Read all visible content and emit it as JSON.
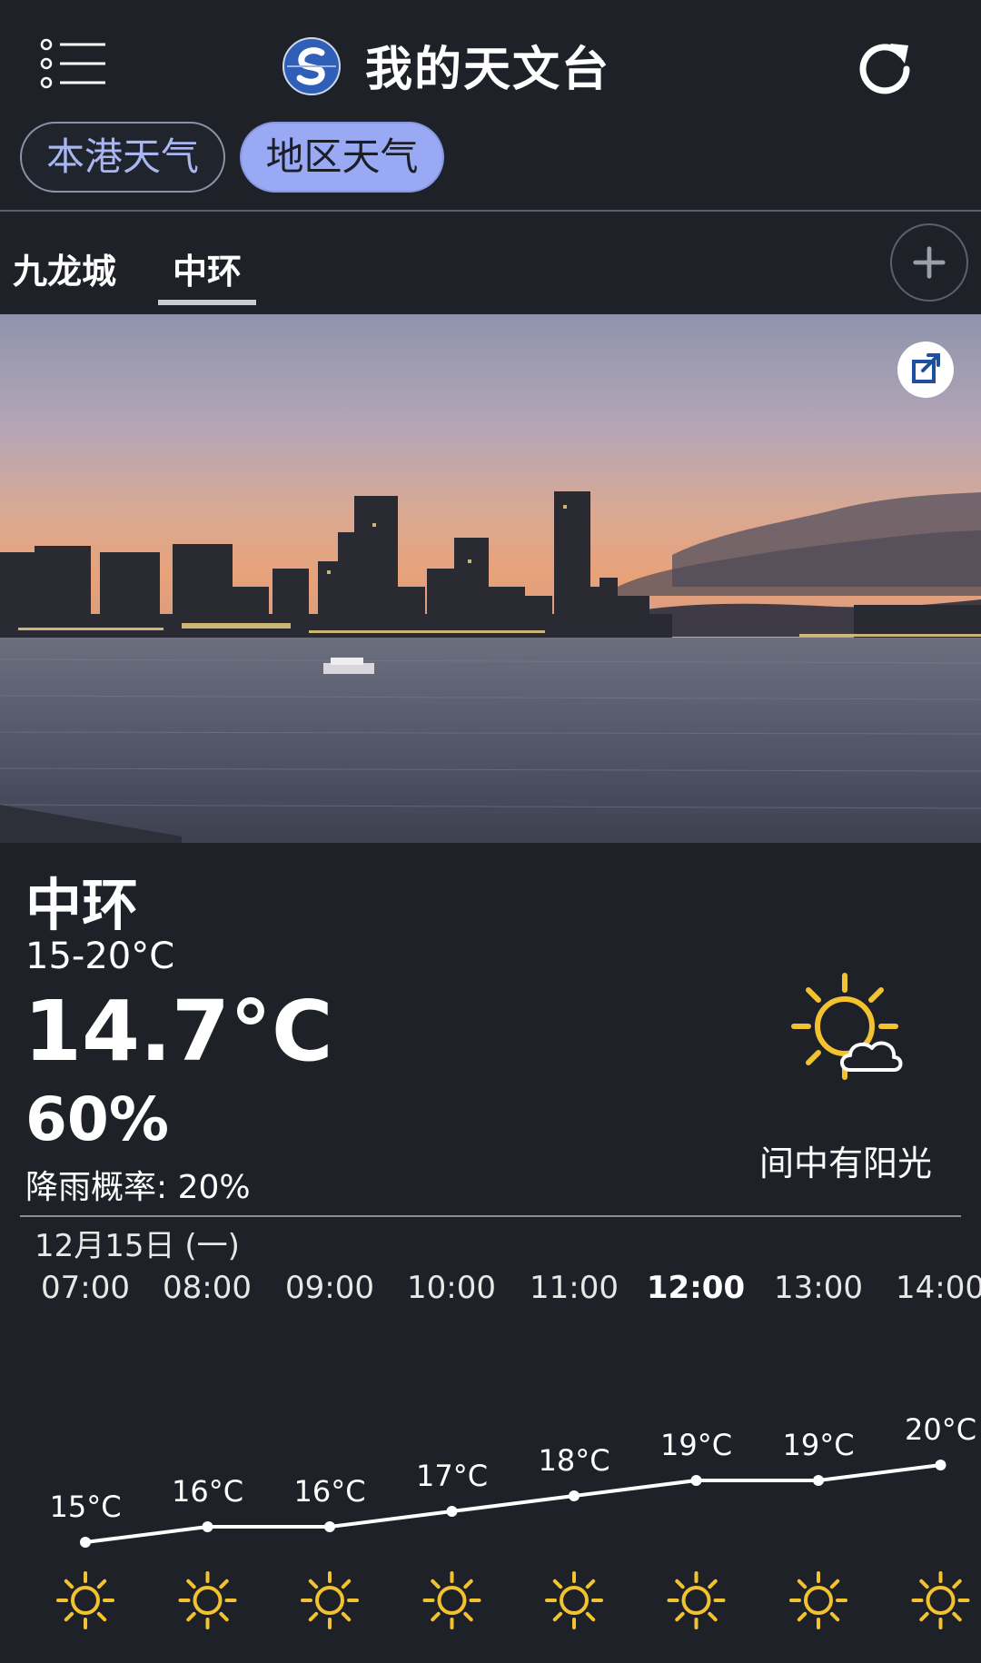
{
  "app": {
    "title": "我的天文台"
  },
  "modes": {
    "local": "本港天气",
    "region": "地区天气"
  },
  "locations": [
    {
      "name": "九龙城"
    },
    {
      "name": "中环",
      "selected": true
    }
  ],
  "current": {
    "place": "中环",
    "temp_range": "15-20°C",
    "temperature": "14.7°C",
    "humidity": "60%",
    "rain_probability": "降雨概率: 20%",
    "description": "间中有阳光",
    "icon": "sunny-periods-icon"
  },
  "hourly": {
    "date": "12月15日 (一)",
    "hours": [
      "07:00",
      "08:00",
      "09:00",
      "10:00",
      "11:00",
      "12:00",
      "13:00",
      "14:00"
    ],
    "active_hour": "12:00",
    "temp_labels": [
      "15°C",
      "16°C",
      "16°C",
      "17°C",
      "18°C",
      "19°C",
      "19°C",
      "20°C"
    ],
    "icon": "sun-icon"
  },
  "chart_data": {
    "type": "line",
    "x": [
      "07:00",
      "08:00",
      "09:00",
      "10:00",
      "11:00",
      "12:00",
      "13:00",
      "14:00"
    ],
    "series": [
      {
        "values": [
          15,
          16,
          16,
          17,
          18,
          19,
          19,
          20
        ]
      }
    ],
    "xlabel": "",
    "ylabel": "",
    "grid": false
  },
  "colors": {
    "background": "#1e2228",
    "accent": "#9aa9f4",
    "sun": "#f2c230",
    "text": "#ffffff"
  }
}
